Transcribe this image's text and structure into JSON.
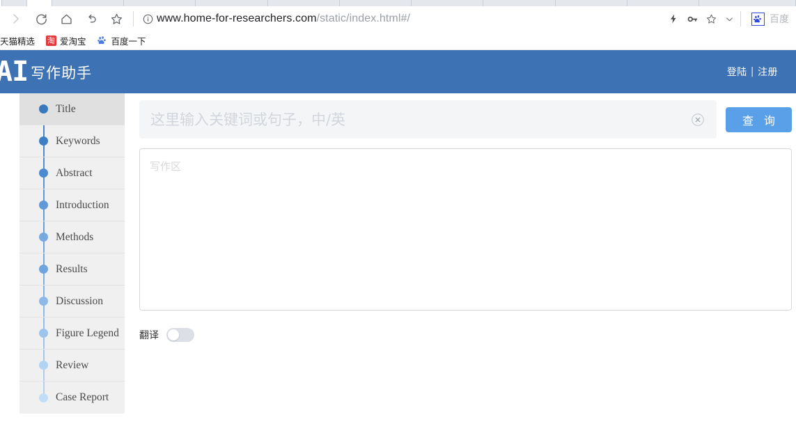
{
  "browser": {
    "toolbar_icons": [
      {
        "name": "forward-icon",
        "glyph": "forward"
      },
      {
        "name": "reload-icon",
        "glyph": "reload"
      },
      {
        "name": "home-icon",
        "glyph": "home"
      },
      {
        "name": "back-arrow-icon",
        "glyph": "undo"
      },
      {
        "name": "bookmark-star-icon",
        "glyph": "star"
      }
    ],
    "url": {
      "site_info_icon": "info-circle-icon",
      "domain": "www.home-for-researchers.com",
      "path": "/static/index.html#/"
    },
    "right_icons": [
      {
        "name": "lightning-icon",
        "glyph": "lightning"
      },
      {
        "name": "key-icon",
        "glyph": "key"
      },
      {
        "name": "star-outline-icon",
        "glyph": "star"
      },
      {
        "name": "chevron-down-icon",
        "glyph": "chevron"
      }
    ],
    "extension": {
      "icon": "baidu-paw-icon",
      "label": "百度"
    },
    "bookmarks": [
      {
        "label": "天猫精选",
        "icon": "tmall-icon"
      },
      {
        "label": "爱淘宝",
        "icon": "taobao-icon"
      },
      {
        "label": "百度一下",
        "icon": "baidu-paw-icon"
      }
    ]
  },
  "header": {
    "logo_text": "AI",
    "logo_subtitle": "写作助手",
    "login_label": "登陆",
    "divider": "|",
    "register_label": "注册",
    "background_color": "#3d72b4"
  },
  "sidebar": {
    "items": [
      {
        "label": "Title",
        "dot_color": "#3878bd",
        "active": true
      },
      {
        "label": "Keywords",
        "dot_color": "#3f7ec4",
        "active": false
      },
      {
        "label": "Abstract",
        "dot_color": "#4d8ace",
        "active": false
      },
      {
        "label": "Introduction",
        "dot_color": "#6198d6",
        "active": false
      },
      {
        "label": "Methods",
        "dot_color": "#77a9de",
        "active": false
      },
      {
        "label": "Results",
        "dot_color": "#6fa4dc",
        "active": false
      },
      {
        "label": "Discussion",
        "dot_color": "#8fbae7",
        "active": false
      },
      {
        "label": "Figure Legend",
        "dot_color": "#9dc4ec",
        "active": false
      },
      {
        "label": "Review",
        "dot_color": "#b3d3f2",
        "active": false
      },
      {
        "label": "Case Report",
        "dot_color": "#c3ddf6",
        "active": false
      }
    ]
  },
  "main": {
    "search": {
      "placeholder": "这里输入关键词或句子，中/英",
      "value": "",
      "clear_icon": "clear-circle-icon",
      "button_label": "查 询",
      "button_color": "#5aa0e8"
    },
    "editor": {
      "placeholder": "写作区",
      "value": ""
    },
    "translate": {
      "label": "翻译",
      "enabled": false
    }
  }
}
